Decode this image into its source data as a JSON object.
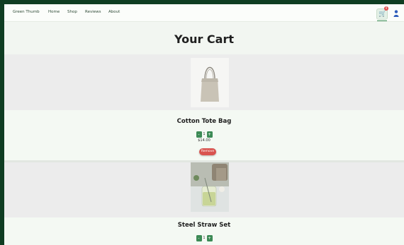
{
  "nav": {
    "brand": "Green Thumb",
    "links": [
      "Home",
      "Shop",
      "Reviews",
      "About"
    ],
    "cart_count": "0",
    "cart_icon": "cart-icon",
    "user_icon": "user-icon"
  },
  "page": {
    "title": "Your Cart"
  },
  "cart_items": [
    {
      "name": "Cotton Tote Bag",
      "quantity": "1",
      "price": "$14.00",
      "decrease": "-",
      "increase": "+",
      "remove_label": "Remove"
    },
    {
      "name": "Steel Straw Set",
      "quantity": "1",
      "decrease": "-",
      "increase": "+"
    }
  ],
  "colors": {
    "accent": "#3c8a55",
    "remove": "#d9534f",
    "outer_bg": "#0f3d22"
  }
}
